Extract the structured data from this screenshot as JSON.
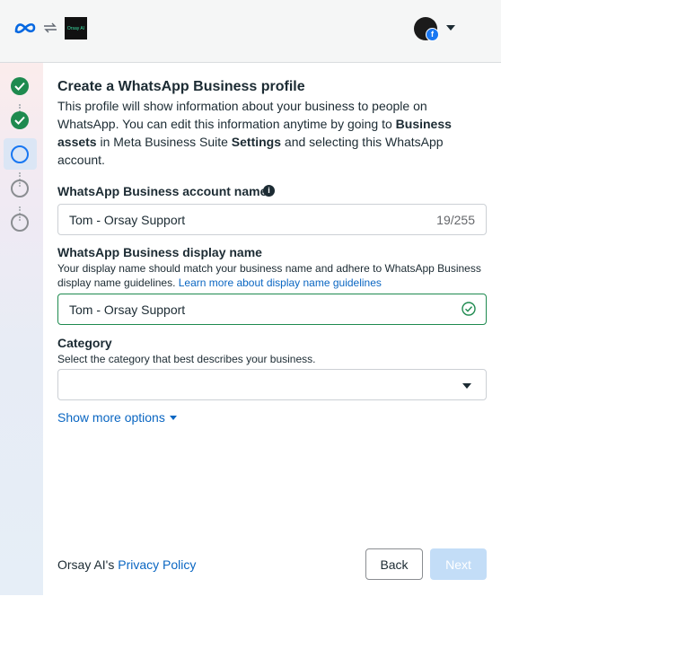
{
  "topbar": {
    "meta_logo_icon": "meta-infinity-icon",
    "sync_icon": "sync-arrows-icon",
    "app_logo_text": "Orsay AI",
    "account_icon": "avatar-with-facebook-badge",
    "menu_icon": "caret-down-icon"
  },
  "steps": [
    {
      "state": "complete"
    },
    {
      "state": "complete"
    },
    {
      "state": "current"
    },
    {
      "state": "pending"
    },
    {
      "state": "pending"
    }
  ],
  "page": {
    "title": "Create a WhatsApp Business profile",
    "intro_part1": "This profile will show information about your business to people on WhatsApp. You can edit this information anytime by going to ",
    "intro_bold1": "Business assets",
    "intro_part2": " in Meta Business Suite ",
    "intro_bold2": "Settings",
    "intro_part3": " and selecting this WhatsApp account."
  },
  "account_name": {
    "label": "WhatsApp Business account name",
    "value": "Tom - Orsay Support",
    "counter": "19/255"
  },
  "display_name": {
    "label": "WhatsApp Business display name",
    "help": "Your display name should match your business name and adhere to WhatsApp Business display name guidelines. ",
    "help_link": "Learn more about display name guidelines",
    "value": "Tom - Orsay Support"
  },
  "category": {
    "label": "Category",
    "help": "Select the category that best describes your business.",
    "value": ""
  },
  "show_more": "Show more options",
  "footer": {
    "owner": "Orsay AI's ",
    "privacy_link": "Privacy Policy",
    "back_label": "Back",
    "next_label": "Next"
  },
  "colors": {
    "accent": "#1877f2",
    "link": "#0a66c2",
    "success": "#1e8a4f",
    "disabled_button": "#c3ddf7"
  }
}
